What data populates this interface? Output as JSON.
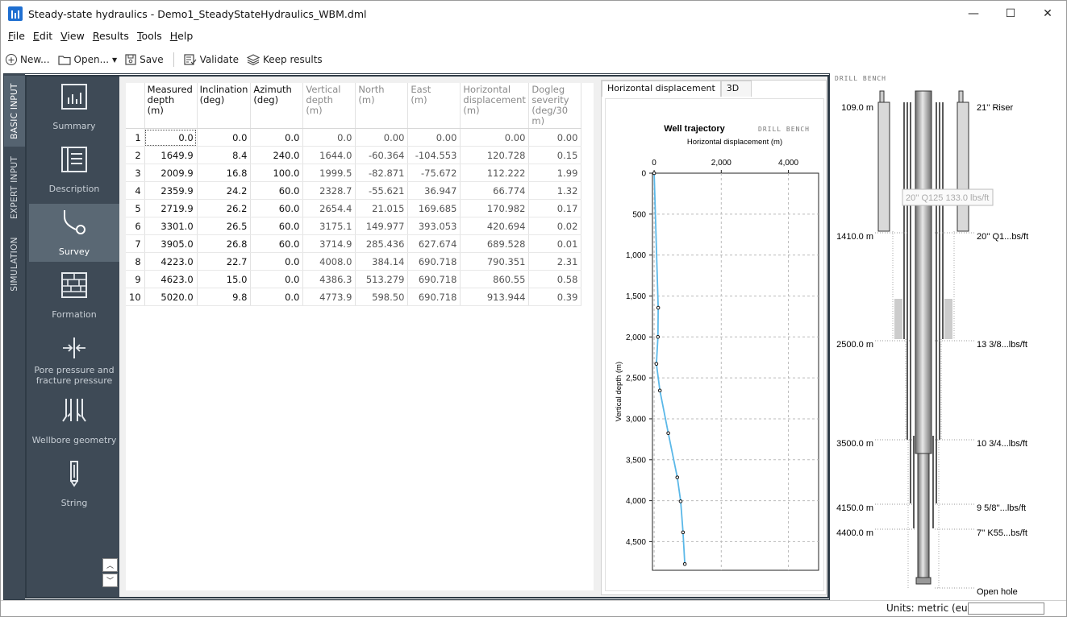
{
  "window": {
    "title": "Steady-state hydraulics - Demo1_SteadyStateHydraulics_WBM.dml",
    "minimize": "—",
    "maximize": "☐",
    "close": "✕"
  },
  "menu": [
    {
      "key": "F",
      "rest": "ile"
    },
    {
      "key": "E",
      "rest": "dit"
    },
    {
      "key": "V",
      "rest": "iew"
    },
    {
      "key": "R",
      "rest": "esults"
    },
    {
      "key": "T",
      "rest": "ools"
    },
    {
      "key": "H",
      "rest": "elp"
    }
  ],
  "toolbar": {
    "new_label": "New...",
    "open_label": "Open...",
    "save_label": "Save",
    "validate_label": "Validate",
    "keep_label": "Keep results"
  },
  "vtabs": {
    "basic": "BASIC INPUT",
    "expert": "EXPERT INPUT",
    "simulation": "SIMULATION"
  },
  "sidebar": {
    "summary": "Summary",
    "description": "Description",
    "survey": "Survey",
    "formation": "Formation",
    "pore": "Pore pressure and fracture pressure",
    "wellbore": "Wellbore geometry",
    "string": "String"
  },
  "table": {
    "headers": [
      {
        "l1": "Measured",
        "l2": "depth",
        "l3": "(m)"
      },
      {
        "l1": "Inclination",
        "l2": "(deg)",
        "l3": ""
      },
      {
        "l1": "Azimuth",
        "l2": "(deg)",
        "l3": ""
      },
      {
        "l1": "Vertical",
        "l2": "depth",
        "l3": "(m)"
      },
      {
        "l1": "North",
        "l2": "(m)",
        "l3": ""
      },
      {
        "l1": "East",
        "l2": "(m)",
        "l3": ""
      },
      {
        "l1": "Horizontal",
        "l2": "displacement",
        "l3": "(m)"
      },
      {
        "l1": "Dogleg",
        "l2": "severity",
        "l3": "(deg/30 m)"
      }
    ],
    "rows": [
      [
        "1",
        "0.0",
        "0.0",
        "0.0",
        "0.0",
        "0.00",
        "0.00",
        "0.00",
        "0.00"
      ],
      [
        "2",
        "1649.9",
        "8.4",
        "240.0",
        "1644.0",
        "-60.364",
        "-104.553",
        "120.728",
        "0.15"
      ],
      [
        "3",
        "2009.9",
        "16.8",
        "100.0",
        "1999.5",
        "-82.871",
        "-75.672",
        "112.222",
        "1.99"
      ],
      [
        "4",
        "2359.9",
        "24.2",
        "60.0",
        "2328.7",
        "-55.621",
        "36.947",
        "66.774",
        "1.32"
      ],
      [
        "5",
        "2719.9",
        "26.2",
        "60.0",
        "2654.4",
        "21.015",
        "169.685",
        "170.982",
        "0.17"
      ],
      [
        "6",
        "3301.0",
        "26.5",
        "60.0",
        "3175.1",
        "149.977",
        "393.053",
        "420.694",
        "0.02"
      ],
      [
        "7",
        "3905.0",
        "26.8",
        "60.0",
        "3714.9",
        "285.436",
        "627.674",
        "689.528",
        "0.01"
      ],
      [
        "8",
        "4223.0",
        "22.7",
        "0.0",
        "4008.0",
        "384.14",
        "690.718",
        "790.351",
        "2.31"
      ],
      [
        "9",
        "4623.0",
        "15.0",
        "0.0",
        "4386.3",
        "513.279",
        "690.718",
        "860.55",
        "0.58"
      ],
      [
        "10",
        "5020.0",
        "9.8",
        "0.0",
        "4773.9",
        "598.50",
        "690.718",
        "913.944",
        "0.39"
      ]
    ]
  },
  "chart_tabs": [
    "Horizontal displacement",
    "3D"
  ],
  "chart_data": {
    "type": "line",
    "title": "Well trajectory",
    "xlabel": "Horizontal displacement (m)",
    "ylabel": "Vertical depth (m)",
    "xlim": [
      -50,
      4900
    ],
    "ylim": [
      0,
      4850
    ],
    "y_inverted": true,
    "x_ticks": [
      "0",
      "2,000",
      "4,000"
    ],
    "x_tick_values": [
      0,
      2000,
      4000
    ],
    "y_ticks": [
      "0",
      "500",
      "1,000",
      "1,500",
      "2,000",
      "2,500",
      "3,000",
      "3,500",
      "4,000",
      "4,500"
    ],
    "y_tick_values": [
      0,
      500,
      1000,
      1500,
      2000,
      2500,
      3000,
      3500,
      4000,
      4500
    ],
    "grid": true,
    "x": [
      0.0,
      120.728,
      112.222,
      66.774,
      170.982,
      420.694,
      689.528,
      790.351,
      860.55,
      913.944
    ],
    "y": [
      0.0,
      1644.0,
      1999.5,
      2328.7,
      2654.4,
      3175.1,
      3714.9,
      4008.0,
      4386.3,
      4773.9
    ],
    "line_color": "#5bb8e8",
    "logo": "DRILL BENCH"
  },
  "schematic": {
    "depths": [
      "109.0 m",
      "1410.0 m",
      "2500.0 m",
      "3500.0 m",
      "4150.0 m",
      "4400.0 m"
    ],
    "labels": [
      "21'' Riser",
      "20'' Q1...bs/ft",
      "13 3/8...lbs/ft",
      "10 3/4...lbs/ft",
      "9 5/8''...lbs/ft",
      "7'' K55...bs/ft",
      "Open hole"
    ],
    "tooltip": "20'' Q125 133.0 lbs/ft",
    "logo": "DRILL BENCH"
  },
  "status": {
    "units": "Units: metric (euro)"
  },
  "colors": {
    "sidebar_bg": "#3e4a56",
    "sidebar_active": "#5a6874",
    "accent": "#1f6fd1",
    "trajectory": "#5bb8e8"
  }
}
